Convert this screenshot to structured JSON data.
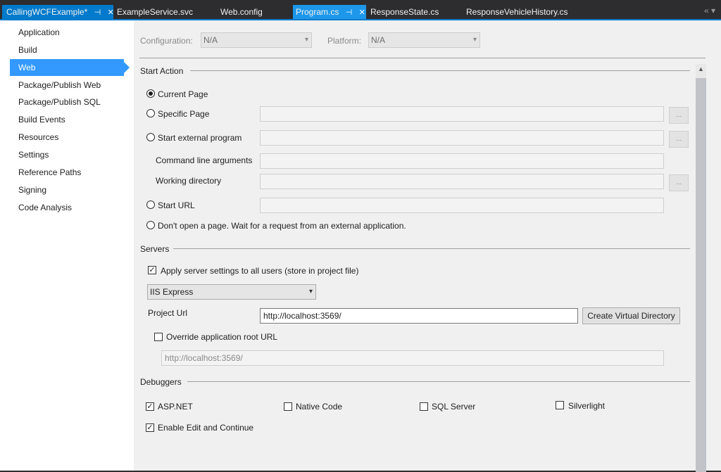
{
  "tabs": [
    {
      "label": "CallingWCFExample*",
      "pin": "⊣",
      "close": "✕"
    },
    {
      "label": "ExampleService.svc"
    },
    {
      "label": "Web.config"
    },
    {
      "label": "Program.cs",
      "pin": "⊣",
      "close": "✕"
    },
    {
      "label": "ResponseState.cs"
    },
    {
      "label": "ResponseVehicleHistory.cs"
    }
  ],
  "tab_overflow": "«  ▾",
  "nav": {
    "items": [
      "Application",
      "Build",
      "Web",
      "Package/Publish Web",
      "Package/Publish SQL",
      "Build Events",
      "Resources",
      "Settings",
      "Reference Paths",
      "Signing",
      "Code Analysis"
    ],
    "selected": "Web"
  },
  "config": {
    "configuration_label": "Configuration:",
    "configuration_value": "N/A",
    "platform_label": "Platform:",
    "platform_value": "N/A"
  },
  "start_action": {
    "title": "Start Action",
    "current_page": "Current Page",
    "specific_page": "Specific Page",
    "external_program": "Start external program",
    "cmd_args": "Command line arguments",
    "working_dir": "Working directory",
    "start_url": "Start URL",
    "dont_open": "Don't open a page.  Wait for a request from an external application.",
    "browse_label": "..."
  },
  "servers": {
    "title": "Servers",
    "apply_all": "Apply server settings to all users (store in project file)",
    "server_type": "IIS Express",
    "project_url_label": "Project Url",
    "project_url": "http://localhost:3569/",
    "create_vdir": "Create Virtual Directory",
    "override_root": "Override application root URL",
    "override_url": "http://localhost:3569/"
  },
  "debuggers": {
    "title": "Debuggers",
    "aspnet": "ASP.NET",
    "native": "Native Code",
    "sql": "SQL Server",
    "silverlight": "Silverlight",
    "edit_continue": "Enable Edit and Continue"
  },
  "colors": {
    "accent": "#007acc",
    "selection": "#3399ff",
    "chrome": "#2d2d30"
  }
}
